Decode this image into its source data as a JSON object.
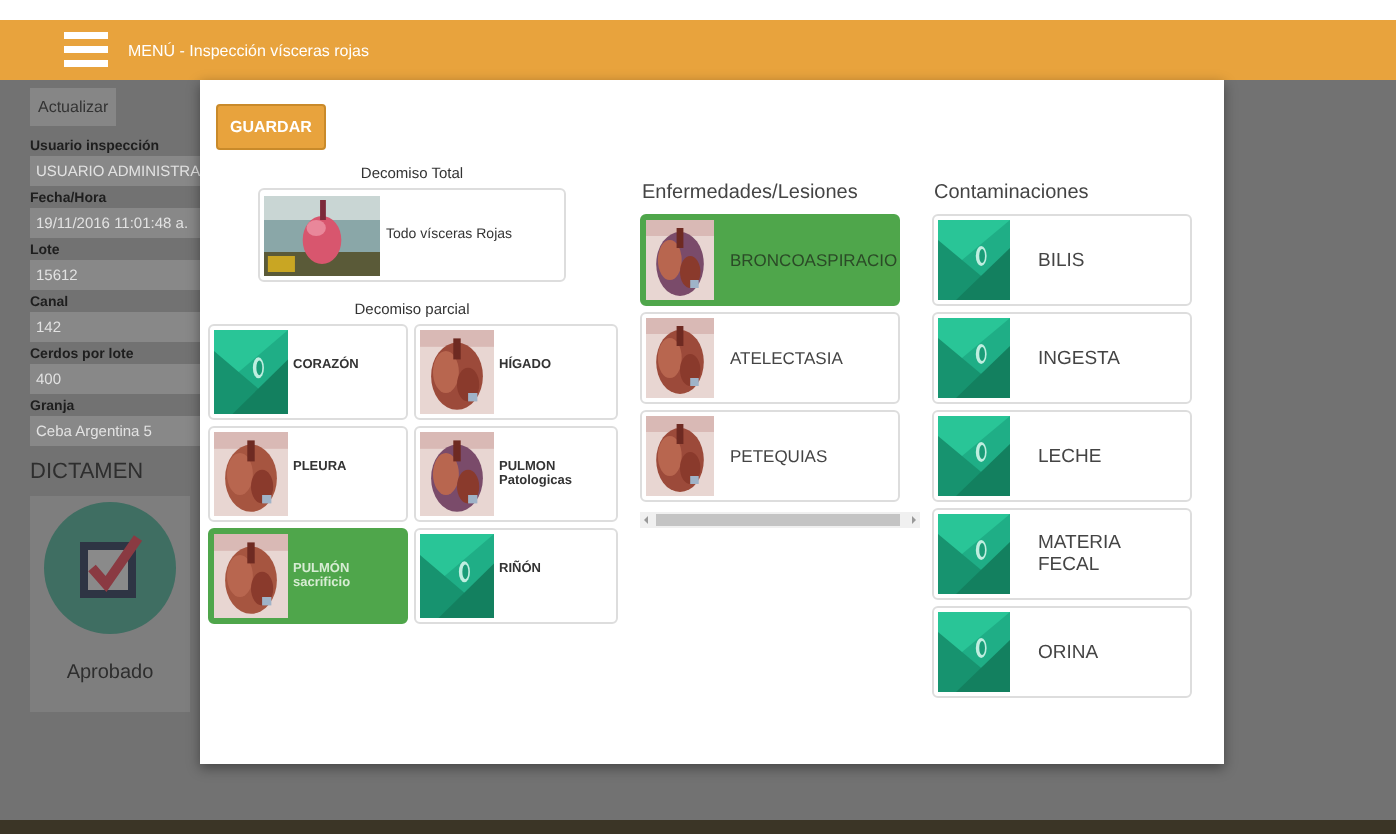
{
  "header": {
    "title": "MENÚ - Inspección vísceras rojas"
  },
  "sidebar": {
    "refresh_button": "Actualizar",
    "fields": [
      {
        "label": "Usuario inspección",
        "value": "USUARIO ADMINISTRA"
      },
      {
        "label": "Fecha/Hora",
        "value": "19/11/2016 11:01:48 a."
      },
      {
        "label": "Lote",
        "value": "15612"
      },
      {
        "label": "Canal",
        "value": "142"
      },
      {
        "label": "Cerdos por lote",
        "value": "400"
      },
      {
        "label": "Granja",
        "value": "Ceba Argentina 5"
      }
    ],
    "dictamen": {
      "heading": "DICTAMEN",
      "status": "Aprobado"
    }
  },
  "dialog": {
    "save_button": "GUARDAR",
    "total": {
      "heading": "Decomiso Total",
      "item": {
        "label": "Todo vísceras Rojas",
        "selected": false
      }
    },
    "partial": {
      "heading": "Decomiso parcial",
      "items": [
        {
          "label": "CORAZÓN",
          "selected": false
        },
        {
          "label": "HÍGADO",
          "selected": false
        },
        {
          "label": "PLEURA",
          "selected": false
        },
        {
          "label": "PULMON Patologicas",
          "selected": false
        },
        {
          "label": "PULMÓN sacrificio",
          "selected": true
        },
        {
          "label": "RIÑÓN",
          "selected": false
        }
      ]
    },
    "diseases": {
      "heading": "Enfermedades/Lesiones",
      "items": [
        {
          "label": "BRONCOASPIRACIO",
          "selected": true
        },
        {
          "label": "ATELECTASIA",
          "selected": false
        },
        {
          "label": "PETEQUIAS",
          "selected": false
        }
      ]
    },
    "contaminations": {
      "heading": "Contaminaciones",
      "items": [
        {
          "label": "BILIS",
          "selected": false
        },
        {
          "label": "INGESTA",
          "selected": false
        },
        {
          "label": "LECHE",
          "selected": false
        },
        {
          "label": "MATERIA FECAL",
          "selected": false
        },
        {
          "label": "ORINA",
          "selected": false
        }
      ]
    }
  }
}
